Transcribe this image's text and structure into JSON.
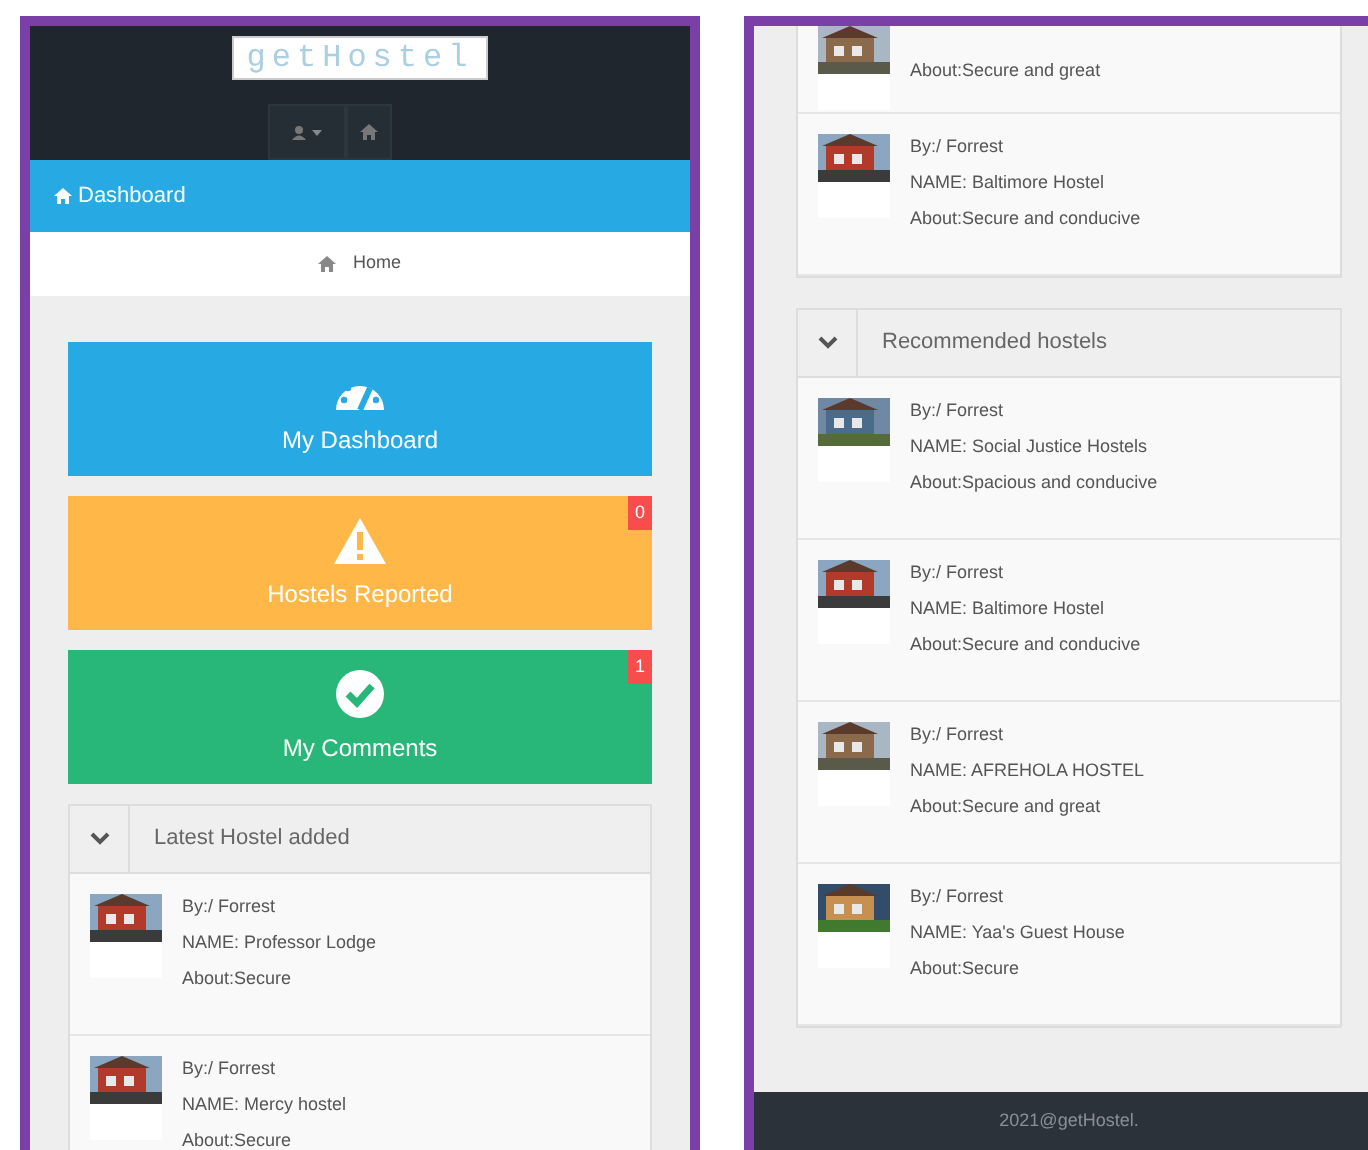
{
  "left_screen": {
    "logo": "getHostel",
    "title_bar": {
      "title": "Dashboard"
    },
    "breadcrumb": "Home",
    "tiles": [
      {
        "kind": "dashboard",
        "label": "My Dashboard",
        "color": "#27a9e3"
      },
      {
        "kind": "warning",
        "label": "Hostels Reported",
        "color": "#ffb848",
        "badge": "0"
      },
      {
        "kind": "check",
        "label": "My Comments",
        "color": "#28b779",
        "badge": "1"
      }
    ],
    "panel": {
      "title": "Latest Hostel added",
      "items": [
        {
          "by": "By:/ Forrest",
          "name": "NAME: Professor Lodge",
          "about": "About:Secure"
        },
        {
          "by": "By:/ Forrest",
          "name": "NAME: Mercy hostel",
          "about": "About:Secure"
        }
      ]
    }
  },
  "right_screen": {
    "panel_top": {
      "items": [
        {
          "about": "About:Secure and great",
          "partial": true
        },
        {
          "by": "By:/ Forrest",
          "name": "NAME: Baltimore Hostel",
          "about": "About:Secure and conducive"
        }
      ]
    },
    "panel": {
      "title": "Recommended hostels",
      "items": [
        {
          "by": "By:/ Forrest",
          "name": "NAME: Social Justice Hostels",
          "about": "About:Spacious and conducive"
        },
        {
          "by": "By:/ Forrest",
          "name": "NAME: Baltimore Hostel",
          "about": "About:Secure and conducive"
        },
        {
          "by": "By:/ Forrest",
          "name": "NAME: AFREHOLA HOSTEL",
          "about": "About:Secure and great"
        },
        {
          "by": "By:/ Forrest",
          "name": "NAME: Yaa's Guest House",
          "about": "About:Secure"
        }
      ]
    },
    "footer": "2021@getHostel."
  }
}
